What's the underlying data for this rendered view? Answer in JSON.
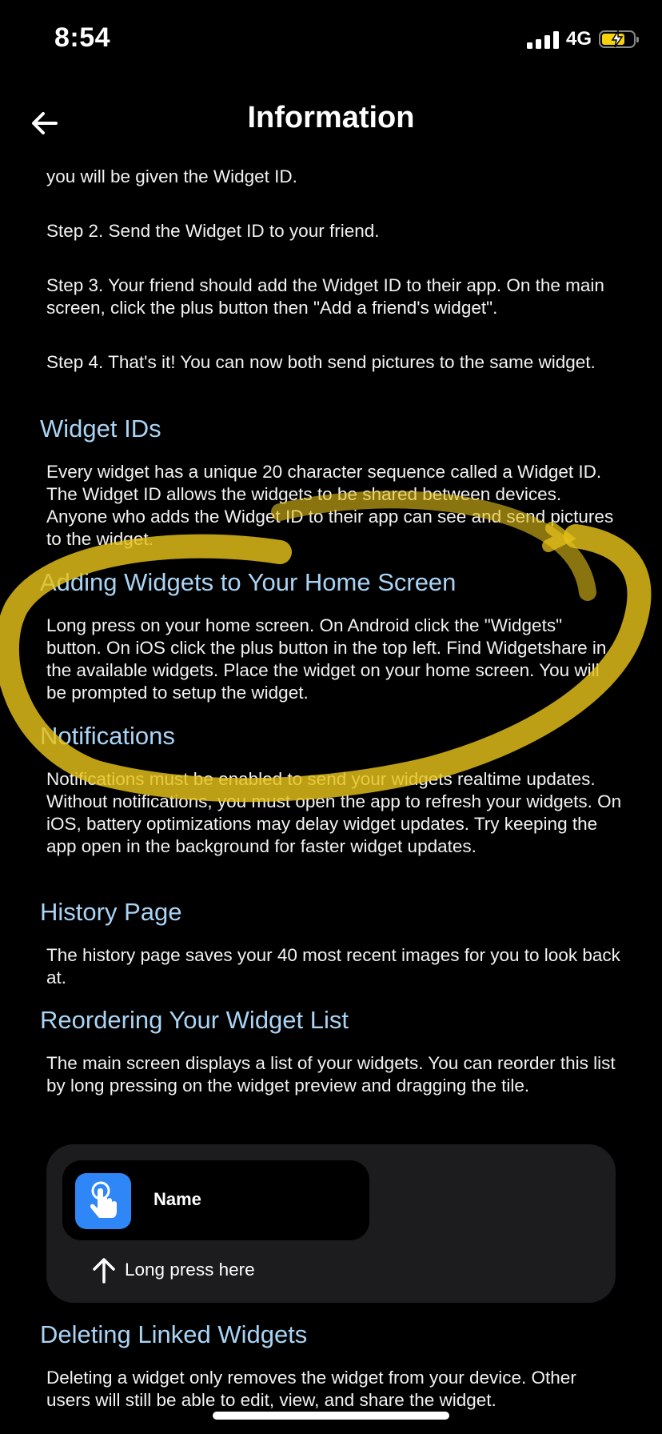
{
  "status": {
    "time": "8:54",
    "network": "4G"
  },
  "header": {
    "title": "Information"
  },
  "intro": [
    "you will be given the Widget ID.",
    "Step 2. Send the Widget ID to your friend.",
    "Step 3. Your friend should add the Widget ID to their app. On the main screen, click the plus button then \"Add a friend's widget\".",
    "Step 4. That's it! You can now both send pictures to the same widget."
  ],
  "sections": [
    {
      "title": "Widget IDs",
      "body": "Every widget has a unique 20 character sequence called a Widget ID. The Widget ID allows the widgets to be shared between devices. Anyone who adds the Widget ID to their app can see and send pictures to the widget."
    },
    {
      "title": "Adding Widgets to Your Home Screen",
      "body": "Long press on your home screen. On Android click the \"Widgets\" button. On iOS click the plus button in the top left. Find Widgetshare in the available widgets. Place the widget on your home screen. You will be prompted to setup the widget."
    },
    {
      "title": "Notifications",
      "body": "Notifications must be enabled to send your widgets realtime updates. Without notifications, you must open the app to refresh your widgets. On iOS, battery optimizations may delay widget updates. Try keeping the app open in the background for faster widget updates."
    },
    {
      "title": "History Page",
      "body": "The history page saves your 40 most recent images for you to look back at."
    },
    {
      "title": "Reordering Your Widget List",
      "body": "The main screen displays a list of your widgets. You can reorder this list by long pressing on the widget preview and dragging the tile."
    },
    {
      "title": "Deleting Linked Widgets",
      "body": "Deleting a widget only removes the widget from your device. Other users will still be able to edit, view, and share the widget."
    }
  ],
  "demo": {
    "tile_name": "Name",
    "hint": "Long press here"
  },
  "colors": {
    "section_title": "#a9d4f5",
    "app_icon": "#2f86f6",
    "battery": "#f5d20b",
    "highlighter": "#e6c21a"
  },
  "icons": [
    "back-arrow-icon",
    "signal-icon",
    "battery-charging-icon",
    "tap-hand-icon",
    "arrow-up-icon"
  ]
}
